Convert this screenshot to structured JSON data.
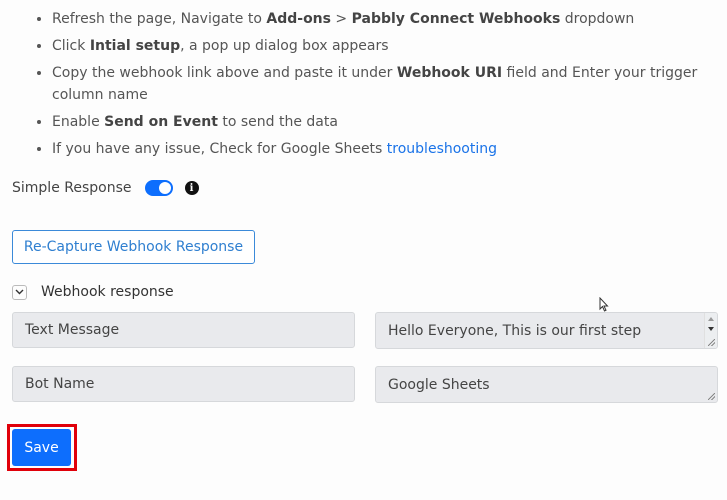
{
  "instructions": {
    "steps": [
      {
        "parts": [
          {
            "text": "Refresh the page, Navigate to "
          },
          {
            "text": "Add-ons",
            "bold": true
          },
          {
            "text": " > "
          },
          {
            "text": "Pabbly Connect Webhooks",
            "bold": true
          },
          {
            "text": " dropdown"
          }
        ]
      },
      {
        "parts": [
          {
            "text": "Click "
          },
          {
            "text": "Intial setup",
            "bold": true
          },
          {
            "text": ", a pop up dialog box appears"
          }
        ]
      },
      {
        "parts": [
          {
            "text": "Copy the webhook link above and paste it under "
          },
          {
            "text": "Webhook URI",
            "bold": true
          },
          {
            "text": " field and Enter your trigger column name"
          }
        ]
      },
      {
        "parts": [
          {
            "text": "Enable "
          },
          {
            "text": "Send on Event",
            "bold": true
          },
          {
            "text": " to send the data"
          }
        ]
      },
      {
        "parts": [
          {
            "text": "If you have any issue, Check for Google Sheets "
          },
          {
            "text": "troubleshooting",
            "link": true
          }
        ]
      }
    ]
  },
  "simple_response": {
    "label": "Simple Response",
    "enabled": true,
    "info_icon": "info-circle-icon"
  },
  "recapture_button": {
    "label": "Re-Capture Webhook Response"
  },
  "webhook_response": {
    "label": "Webhook response",
    "toggle_icon": "chevron-down-icon",
    "fields": [
      {
        "key": "Text Message",
        "value": "Hello Everyone, This is our first step"
      },
      {
        "key": "Bot Name",
        "value": "Google Sheets"
      }
    ]
  },
  "save_button": {
    "label": "Save"
  },
  "colors": {
    "primary": "#0d6efd",
    "highlight_outline": "#e0000a",
    "link": "#1a73e8"
  }
}
